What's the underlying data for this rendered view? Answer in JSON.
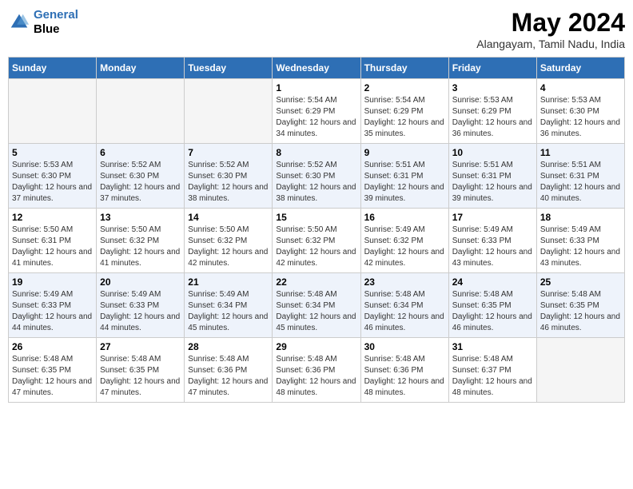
{
  "header": {
    "logo_line1": "General",
    "logo_line2": "Blue",
    "month_title": "May 2024",
    "subtitle": "Alangayam, Tamil Nadu, India"
  },
  "days_of_week": [
    "Sunday",
    "Monday",
    "Tuesday",
    "Wednesday",
    "Thursday",
    "Friday",
    "Saturday"
  ],
  "weeks": [
    [
      {
        "day": "",
        "sunrise": "",
        "sunset": "",
        "daylight": "",
        "empty": true
      },
      {
        "day": "",
        "sunrise": "",
        "sunset": "",
        "daylight": "",
        "empty": true
      },
      {
        "day": "",
        "sunrise": "",
        "sunset": "",
        "daylight": "",
        "empty": true
      },
      {
        "day": "1",
        "sunrise": "Sunrise: 5:54 AM",
        "sunset": "Sunset: 6:29 PM",
        "daylight": "Daylight: 12 hours and 34 minutes."
      },
      {
        "day": "2",
        "sunrise": "Sunrise: 5:54 AM",
        "sunset": "Sunset: 6:29 PM",
        "daylight": "Daylight: 12 hours and 35 minutes."
      },
      {
        "day": "3",
        "sunrise": "Sunrise: 5:53 AM",
        "sunset": "Sunset: 6:29 PM",
        "daylight": "Daylight: 12 hours and 36 minutes."
      },
      {
        "day": "4",
        "sunrise": "Sunrise: 5:53 AM",
        "sunset": "Sunset: 6:30 PM",
        "daylight": "Daylight: 12 hours and 36 minutes."
      }
    ],
    [
      {
        "day": "5",
        "sunrise": "Sunrise: 5:53 AM",
        "sunset": "Sunset: 6:30 PM",
        "daylight": "Daylight: 12 hours and 37 minutes."
      },
      {
        "day": "6",
        "sunrise": "Sunrise: 5:52 AM",
        "sunset": "Sunset: 6:30 PM",
        "daylight": "Daylight: 12 hours and 37 minutes."
      },
      {
        "day": "7",
        "sunrise": "Sunrise: 5:52 AM",
        "sunset": "Sunset: 6:30 PM",
        "daylight": "Daylight: 12 hours and 38 minutes."
      },
      {
        "day": "8",
        "sunrise": "Sunrise: 5:52 AM",
        "sunset": "Sunset: 6:30 PM",
        "daylight": "Daylight: 12 hours and 38 minutes."
      },
      {
        "day": "9",
        "sunrise": "Sunrise: 5:51 AM",
        "sunset": "Sunset: 6:31 PM",
        "daylight": "Daylight: 12 hours and 39 minutes."
      },
      {
        "day": "10",
        "sunrise": "Sunrise: 5:51 AM",
        "sunset": "Sunset: 6:31 PM",
        "daylight": "Daylight: 12 hours and 39 minutes."
      },
      {
        "day": "11",
        "sunrise": "Sunrise: 5:51 AM",
        "sunset": "Sunset: 6:31 PM",
        "daylight": "Daylight: 12 hours and 40 minutes."
      }
    ],
    [
      {
        "day": "12",
        "sunrise": "Sunrise: 5:50 AM",
        "sunset": "Sunset: 6:31 PM",
        "daylight": "Daylight: 12 hours and 41 minutes."
      },
      {
        "day": "13",
        "sunrise": "Sunrise: 5:50 AM",
        "sunset": "Sunset: 6:32 PM",
        "daylight": "Daylight: 12 hours and 41 minutes."
      },
      {
        "day": "14",
        "sunrise": "Sunrise: 5:50 AM",
        "sunset": "Sunset: 6:32 PM",
        "daylight": "Daylight: 12 hours and 42 minutes."
      },
      {
        "day": "15",
        "sunrise": "Sunrise: 5:50 AM",
        "sunset": "Sunset: 6:32 PM",
        "daylight": "Daylight: 12 hours and 42 minutes."
      },
      {
        "day": "16",
        "sunrise": "Sunrise: 5:49 AM",
        "sunset": "Sunset: 6:32 PM",
        "daylight": "Daylight: 12 hours and 42 minutes."
      },
      {
        "day": "17",
        "sunrise": "Sunrise: 5:49 AM",
        "sunset": "Sunset: 6:33 PM",
        "daylight": "Daylight: 12 hours and 43 minutes."
      },
      {
        "day": "18",
        "sunrise": "Sunrise: 5:49 AM",
        "sunset": "Sunset: 6:33 PM",
        "daylight": "Daylight: 12 hours and 43 minutes."
      }
    ],
    [
      {
        "day": "19",
        "sunrise": "Sunrise: 5:49 AM",
        "sunset": "Sunset: 6:33 PM",
        "daylight": "Daylight: 12 hours and 44 minutes."
      },
      {
        "day": "20",
        "sunrise": "Sunrise: 5:49 AM",
        "sunset": "Sunset: 6:33 PM",
        "daylight": "Daylight: 12 hours and 44 minutes."
      },
      {
        "day": "21",
        "sunrise": "Sunrise: 5:49 AM",
        "sunset": "Sunset: 6:34 PM",
        "daylight": "Daylight: 12 hours and 45 minutes."
      },
      {
        "day": "22",
        "sunrise": "Sunrise: 5:48 AM",
        "sunset": "Sunset: 6:34 PM",
        "daylight": "Daylight: 12 hours and 45 minutes."
      },
      {
        "day": "23",
        "sunrise": "Sunrise: 5:48 AM",
        "sunset": "Sunset: 6:34 PM",
        "daylight": "Daylight: 12 hours and 46 minutes."
      },
      {
        "day": "24",
        "sunrise": "Sunrise: 5:48 AM",
        "sunset": "Sunset: 6:35 PM",
        "daylight": "Daylight: 12 hours and 46 minutes."
      },
      {
        "day": "25",
        "sunrise": "Sunrise: 5:48 AM",
        "sunset": "Sunset: 6:35 PM",
        "daylight": "Daylight: 12 hours and 46 minutes."
      }
    ],
    [
      {
        "day": "26",
        "sunrise": "Sunrise: 5:48 AM",
        "sunset": "Sunset: 6:35 PM",
        "daylight": "Daylight: 12 hours and 47 minutes."
      },
      {
        "day": "27",
        "sunrise": "Sunrise: 5:48 AM",
        "sunset": "Sunset: 6:35 PM",
        "daylight": "Daylight: 12 hours and 47 minutes."
      },
      {
        "day": "28",
        "sunrise": "Sunrise: 5:48 AM",
        "sunset": "Sunset: 6:36 PM",
        "daylight": "Daylight: 12 hours and 47 minutes."
      },
      {
        "day": "29",
        "sunrise": "Sunrise: 5:48 AM",
        "sunset": "Sunset: 6:36 PM",
        "daylight": "Daylight: 12 hours and 48 minutes."
      },
      {
        "day": "30",
        "sunrise": "Sunrise: 5:48 AM",
        "sunset": "Sunset: 6:36 PM",
        "daylight": "Daylight: 12 hours and 48 minutes."
      },
      {
        "day": "31",
        "sunrise": "Sunrise: 5:48 AM",
        "sunset": "Sunset: 6:37 PM",
        "daylight": "Daylight: 12 hours and 48 minutes."
      },
      {
        "day": "",
        "sunrise": "",
        "sunset": "",
        "daylight": "",
        "empty": true
      }
    ]
  ]
}
